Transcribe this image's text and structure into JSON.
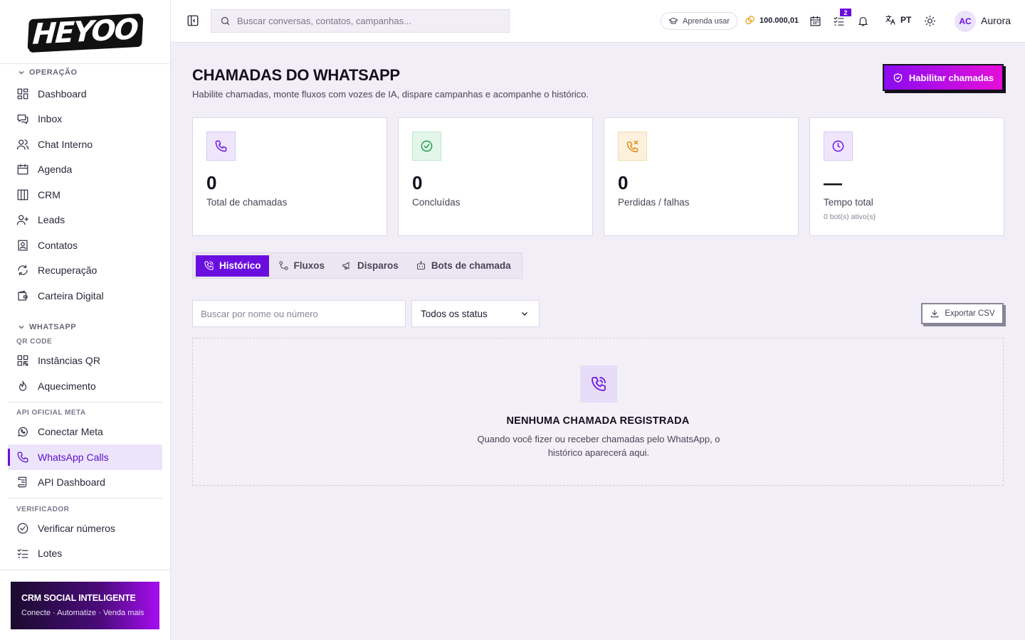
{
  "brand": {
    "logo_text": "HEYOO"
  },
  "sidebar": {
    "operacao": {
      "title": "OPERAÇÃO",
      "items": [
        {
          "label": "Dashboard",
          "icon": "dashboard-icon"
        },
        {
          "label": "Inbox",
          "icon": "inbox-icon"
        },
        {
          "label": "Chat Interno",
          "icon": "users-icon"
        },
        {
          "label": "Agenda",
          "icon": "calendar-icon"
        },
        {
          "label": "CRM",
          "icon": "kanban-icon"
        },
        {
          "label": "Leads",
          "icon": "user-plus-icon"
        },
        {
          "label": "Contatos",
          "icon": "contact-book-icon"
        },
        {
          "label": "Recuperação",
          "icon": "refresh-icon"
        },
        {
          "label": "Carteira Digital",
          "icon": "wallet-icon"
        }
      ]
    },
    "whatsapp": {
      "title": "WHATSAPP",
      "qr_title": "QR CODE",
      "qr_items": [
        {
          "label": "Instâncias QR",
          "icon": "qr-code-icon"
        },
        {
          "label": "Aquecimento",
          "icon": "flame-icon"
        }
      ],
      "api_title": "API OFICIAL META",
      "api_items": [
        {
          "label": "Conectar Meta",
          "icon": "whatsapp-icon"
        },
        {
          "label": "WhatsApp Calls",
          "icon": "phone-icon",
          "active": true
        },
        {
          "label": "API Dashboard",
          "icon": "scroll-icon"
        }
      ]
    },
    "verificador": {
      "title": "VERIFICADOR",
      "items": [
        {
          "label": "Verificar números",
          "icon": "check-circle-icon"
        },
        {
          "label": "Lotes",
          "icon": "list-check-icon"
        }
      ]
    },
    "promo": {
      "title": "CRM SOCIAL INTELIGENTE",
      "subtitle": "Conecte · Automatize · Venda mais"
    }
  },
  "topbar": {
    "search_placeholder": "Buscar conversas, contatos, campanhas...",
    "learn_label": "Aprenda usar",
    "coins": "100.000,01",
    "tasks_badge": "2",
    "language": "PT",
    "user_initials": "AC",
    "user_name": "Aurora"
  },
  "page": {
    "title": "CHAMADAS DO WHATSAPP",
    "subtitle": "Habilite chamadas, monte fluxos com vozes de IA, dispare campanhas e acompanhe o histórico.",
    "enable_button": "Habilitar chamadas"
  },
  "stats": [
    {
      "value": "0",
      "label": "Total de chamadas",
      "icon": "phone-icon",
      "color": "#6a0ee0"
    },
    {
      "value": "0",
      "label": "Concluídas",
      "icon": "check-circle-icon",
      "color": "#189a4a"
    },
    {
      "value": "0",
      "label": "Perdidas / falhas",
      "icon": "phone-missed-icon",
      "color": "#e08a10"
    },
    {
      "value": "—",
      "label": "Tempo total",
      "note": "0 bot(s) ativo(s)",
      "icon": "clock-icon",
      "color": "#6a0ee0"
    }
  ],
  "tabs": [
    {
      "label": "Histórico",
      "icon": "phone-call-icon",
      "active": true
    },
    {
      "label": "Fluxos",
      "icon": "workflow-icon"
    },
    {
      "label": "Disparos",
      "icon": "megaphone-icon"
    },
    {
      "label": "Bots de chamada",
      "icon": "bot-icon"
    }
  ],
  "filters": {
    "search_placeholder": "Buscar por nome ou número",
    "status_selected": "Todos os status",
    "export_label": "Exportar CSV"
  },
  "empty_state": {
    "title": "NENHUMA CHAMADA REGISTRADA",
    "description": "Quando você fizer ou receber chamadas pelo WhatsApp, o histórico aparecerá aqui."
  },
  "colors": {
    "accent": "#6a0ee0",
    "accent_pink": "#e60ed8",
    "background": "#f1eef7"
  }
}
